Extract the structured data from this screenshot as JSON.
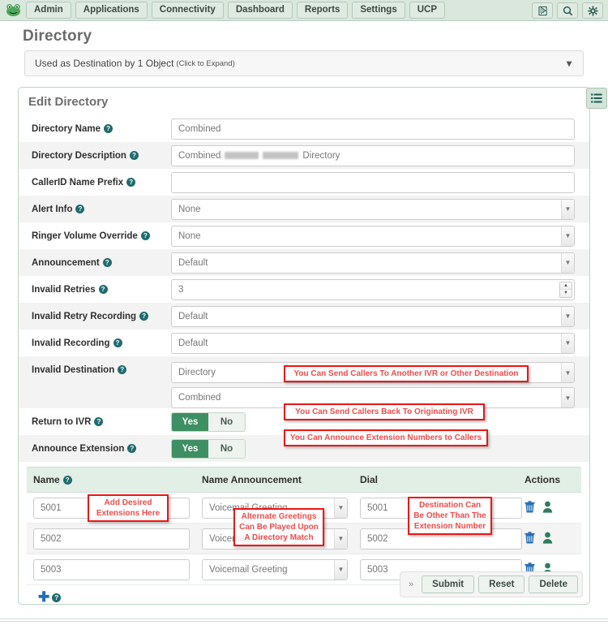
{
  "navbar": {
    "logo_icon": "frog-logo-icon",
    "items": [
      {
        "label": "Admin"
      },
      {
        "label": "Applications"
      },
      {
        "label": "Connectivity"
      },
      {
        "label": "Dashboard"
      },
      {
        "label": "Reports"
      },
      {
        "label": "Settings"
      },
      {
        "label": "UCP"
      }
    ],
    "right_icons": [
      {
        "name": "book-flag-icon"
      },
      {
        "name": "search-icon"
      },
      {
        "name": "gear-icon"
      }
    ]
  },
  "page": {
    "title": "Directory",
    "destination_bar": {
      "text": "Used as Destination by 1 Object",
      "hint": "(Click to Expand)",
      "chevron": "chevron-down-icon"
    }
  },
  "panel": {
    "title": "Edit Directory",
    "side_tab_icon": "list-menu-icon",
    "fields": [
      {
        "label": "Directory Name",
        "type": "text",
        "value": "Combined"
      },
      {
        "label": "Directory Description",
        "type": "redacted_text",
        "prefix": "Combined",
        "suffix": "Directory"
      },
      {
        "label": "CallerID Name Prefix",
        "type": "text",
        "value": ""
      },
      {
        "label": "Alert Info",
        "type": "select",
        "value": "None"
      },
      {
        "label": "Ringer Volume Override",
        "type": "select",
        "value": "None"
      },
      {
        "label": "Announcement",
        "type": "select",
        "value": "Default"
      },
      {
        "label": "Invalid Retries",
        "type": "number",
        "value": "3"
      },
      {
        "label": "Invalid Retry Recording",
        "type": "select",
        "value": "Default"
      },
      {
        "label": "Invalid Recording",
        "type": "select",
        "value": "Default"
      }
    ],
    "invalid_destination": {
      "label": "Invalid Destination",
      "value1": "Directory",
      "value2": "Combined"
    },
    "return_to_ivr": {
      "label": "Return to IVR",
      "yes": "Yes",
      "no": "No",
      "selected": "Yes"
    },
    "announce_extension": {
      "label": "Announce Extension",
      "yes": "Yes",
      "no": "No",
      "selected": "Yes"
    }
  },
  "table": {
    "headers": {
      "name": "Name",
      "announcement": "Name Announcement",
      "dial": "Dial",
      "actions": "Actions"
    },
    "rows": [
      {
        "name": "5001",
        "announcement": "Voicemail Greeting",
        "dial": "5001",
        "delete_icon": "trash-icon",
        "user_icon": "user-icon"
      },
      {
        "name": "5002",
        "announcement": "Voicemail Greeting",
        "dial": "5002",
        "delete_icon": "trash-icon",
        "user_icon": "user-icon"
      },
      {
        "name": "5003",
        "announcement": "Voicemail Greeting",
        "dial": "5003",
        "delete_icon": "trash-icon",
        "user_icon": "user-icon"
      }
    ],
    "add_icon": "plus-icon"
  },
  "footer": {
    "expander": "»",
    "submit": "Submit",
    "reset": "Reset",
    "delete": "Delete"
  },
  "annotations": [
    {
      "text": "You Can Send Callers To Another IVR or Other Destination"
    },
    {
      "text": "You Can Send Callers Back To Originating IVR"
    },
    {
      "text": "You Can Announce Extension Numbers to Callers"
    },
    {
      "text": "Add Desired Extensions Here"
    },
    {
      "text": "Alternate Greetings Can Be Played Upon A Directory Match"
    },
    {
      "text": "Destination Can Be Other Than The Extension Number"
    }
  ],
  "colors": {
    "nav_bg": "#d9e7dd",
    "toggle_on": "#3e8f63",
    "annotation_red": "#f01414",
    "panel_border": "#bcd7c4",
    "table_header_bg": "#e2efe6"
  }
}
